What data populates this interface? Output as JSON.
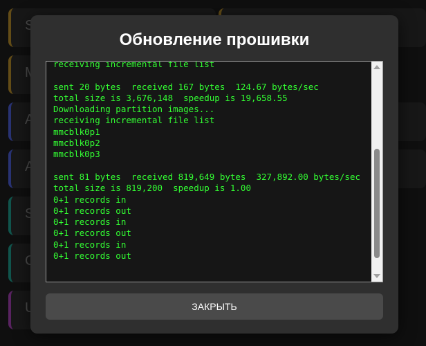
{
  "background": {
    "tiles": [
      {
        "label": "S",
        "accent": "#b58b2a"
      },
      {
        "label": "M",
        "accent": "#b58b2a"
      },
      {
        "label": "A",
        "accent": "#4a5bd0"
      },
      {
        "label": "A",
        "accent": "#4a5bd0"
      },
      {
        "label": "S",
        "accent": "#1e9a8a"
      },
      {
        "label": "C",
        "accent": "#1e9a8a"
      },
      {
        "label": "U",
        "accent": "#a040b0"
      }
    ]
  },
  "modal": {
    "title": "Обновление прошивки",
    "log_lines": [
      "receiving incremental file list",
      "",
      "sent 20 bytes  received 167 bytes  124.67 bytes/sec",
      "total size is 3,676,148  speedup is 19,658.55",
      "Downloading partition images...",
      "receiving incremental file list",
      "mmcblk0p1",
      "mmcblk0p2",
      "mmcblk0p3",
      "",
      "sent 81 bytes  received 819,649 bytes  327,892.00 bytes/sec",
      "total size is 819,200  speedup is 1.00",
      "0+1 records in",
      "0+1 records out",
      "0+1 records in",
      "0+1 records out",
      "0+1 records in",
      "0+1 records out"
    ],
    "close_label": "ЗАКРЫТЬ"
  },
  "colors": {
    "log_text": "#33ff33",
    "modal_bg": "#2f2f2f",
    "button_bg": "#4a4a4a"
  }
}
